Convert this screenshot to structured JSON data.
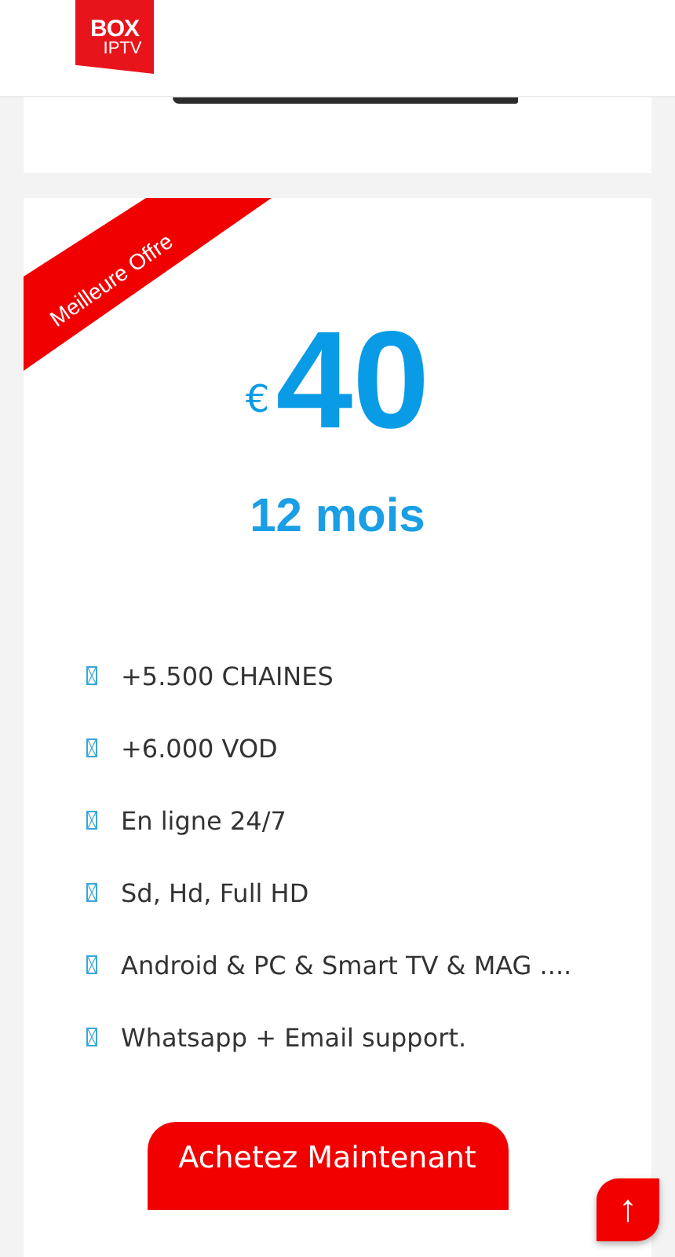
{
  "header": {
    "logo": {
      "top": "BOX",
      "bottom": "IPTV"
    }
  },
  "plan": {
    "ribbon": "Meilleure Offre",
    "currency": "€",
    "price": "40",
    "duration": "12 mois",
    "features": [
      "+5.500 CHAINES",
      "+6.000 VOD",
      "En ligne 24/7",
      "Sd, Hd, Full HD",
      "Android & PC & Smart TV & MAG ....",
      "Whatsapp + Email support."
    ],
    "button": "Achetez Maintenant"
  },
  "scroll_top": "↑"
}
